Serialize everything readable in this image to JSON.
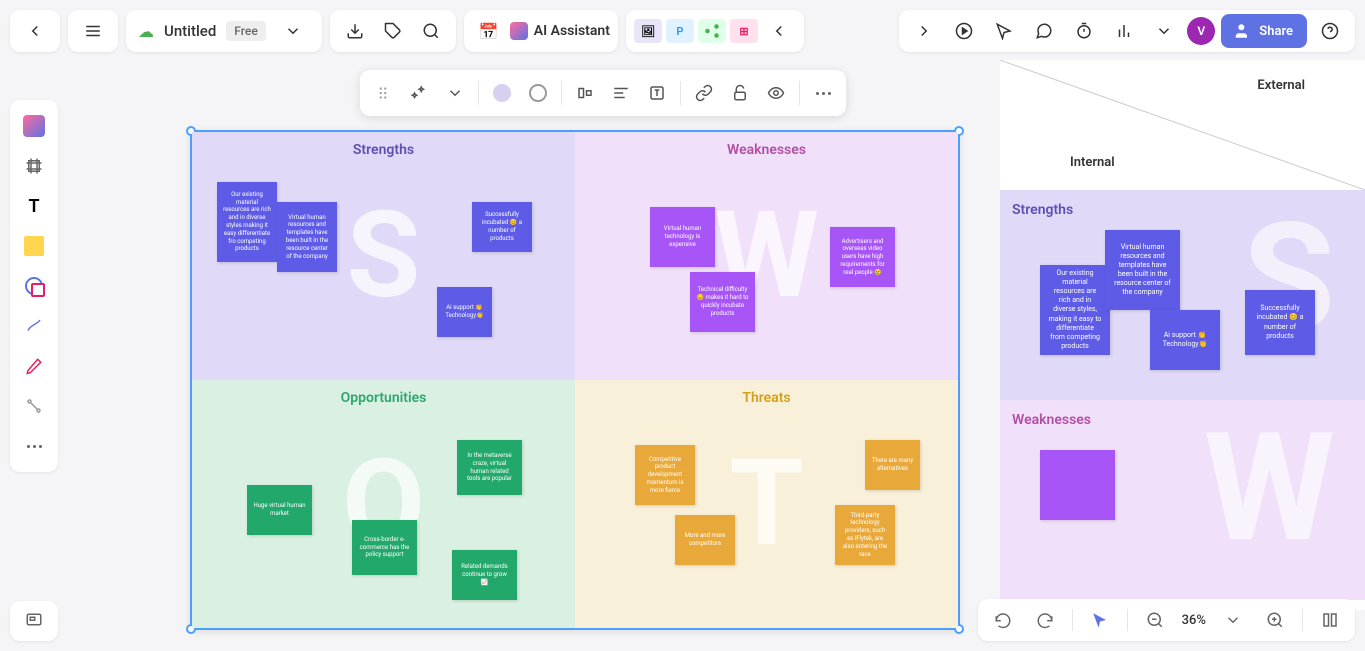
{
  "header": {
    "title": "Untitled",
    "plan_badge": "Free",
    "ai_label": "AI Assistant"
  },
  "share_button": "Share",
  "user_initial": "V",
  "zoom": "36%",
  "swot": {
    "strengths": {
      "title": "Strengths",
      "letter": "S",
      "notes": [
        "Our existing material resources are rich and in diverse styles making it easy differentiate fro competing products",
        "Virtual human resources and templates have been built in the resource center of the company",
        "Successfully incubated 😊 a number of products",
        "Ai support 👏Technology👏"
      ]
    },
    "weaknesses": {
      "title": "Weaknesses",
      "letter": "W",
      "notes": [
        "Virtual human technology is expensive",
        "Technical difficulty 😔 makes it hard to quickly incubate products",
        "Advertisers and overseas video users have high requirements for real people 😢"
      ]
    },
    "opportunities": {
      "title": "Opportunities",
      "letter": "O",
      "notes": [
        "Huge virtual human market",
        "In the metaverse craze, virtual human related tools are popular",
        "Cross-border e-commerce has the policy support",
        "Related demands continue to grow 📈"
      ]
    },
    "threats": {
      "title": "Threats",
      "letter": "T",
      "notes": [
        "Competitive product development momentum is more fierce",
        "More and more competitors",
        "There are many alternatives",
        "Third-party technology providers, such as iFlytek, are also entering the race"
      ]
    }
  },
  "side_preview": {
    "external": "External",
    "internal": "Internal",
    "s_title": "Strengths",
    "w_title": "Weaknesses",
    "s_notes": [
      "Our existing material resources are rich and in diverse styles, making it easy to differentiate from competing products",
      "Virtual human resources and templates have been built in the resource center of the company",
      "Ai support 👏Technology👏",
      "Successfully incubated 😊 a number of products"
    ]
  }
}
